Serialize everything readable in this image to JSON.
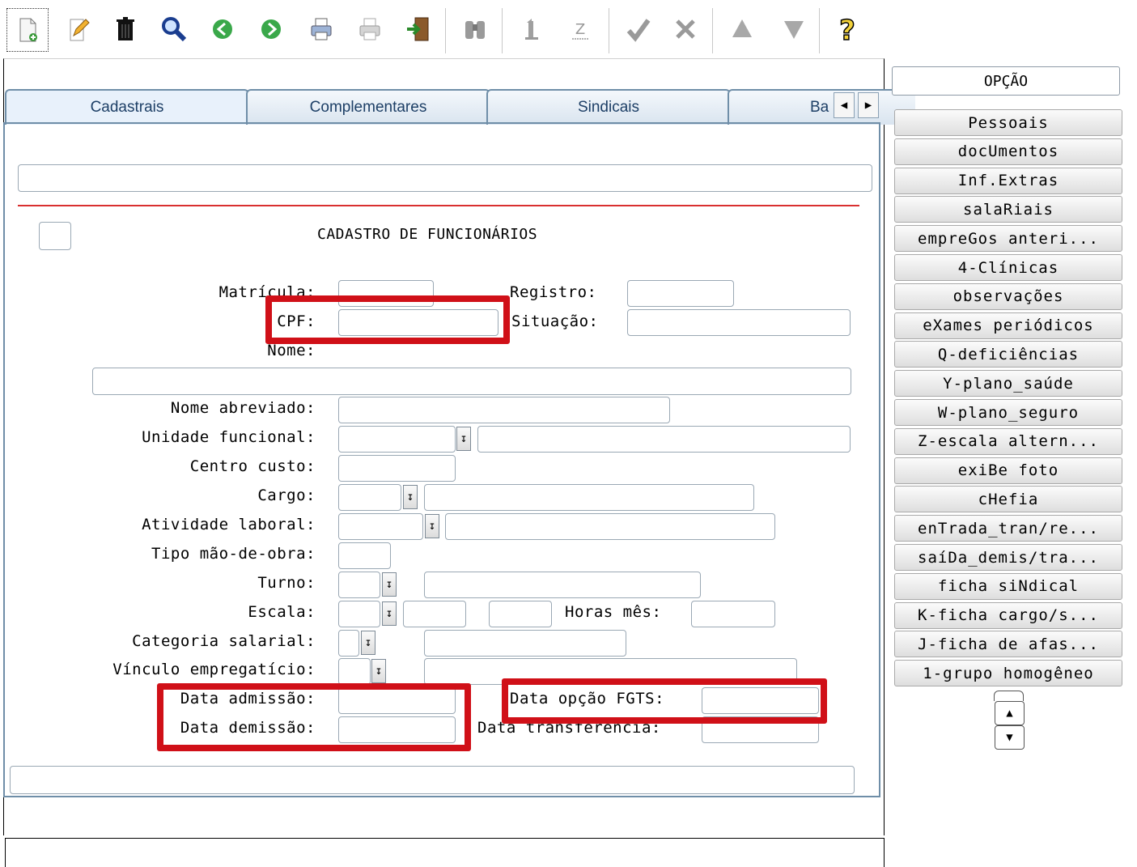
{
  "toolbar": {
    "buttons": [
      {
        "name": "new-icon"
      },
      {
        "name": "edit-icon"
      },
      {
        "name": "delete-icon"
      },
      {
        "name": "search-icon"
      },
      {
        "name": "previous-icon"
      },
      {
        "name": "next-icon"
      },
      {
        "name": "print-icon"
      },
      {
        "name": "print-disabled-icon"
      },
      {
        "name": "exit-icon"
      },
      {
        "name": "binoculars-icon"
      },
      {
        "name": "first-icon"
      },
      {
        "name": "last-icon"
      },
      {
        "name": "confirm-icon"
      },
      {
        "name": "cancel-icon"
      },
      {
        "name": "up-icon"
      },
      {
        "name": "down-icon"
      },
      {
        "name": "help-icon"
      }
    ]
  },
  "tabs": [
    "Cadastrais",
    "Complementares",
    "Sindicais",
    "Ba"
  ],
  "form": {
    "title": "CADASTRO DE FUNCIONÁRIOS",
    "labels": {
      "matricula": "Matrícula:",
      "registro": "Registro:",
      "cpf": "CPF:",
      "situacao": "Situação:",
      "nome": "Nome:",
      "nome_abreviado": "Nome abreviado:",
      "unidade_funcional": "Unidade funcional:",
      "centro_custo": "Centro custo:",
      "cargo": "Cargo:",
      "atividade_laboral": "Atividade laboral:",
      "tipo_mao_de_obra": "Tipo mão-de-obra:",
      "turno": "Turno:",
      "escala": "Escala:",
      "horas_mes": "Horas mês:",
      "categoria_salarial": "Categoria salarial:",
      "vinculo": "Vínculo empregatício:",
      "data_admissao": "Data admissão:",
      "data_opcao_fgts": "Data opção FGTS:",
      "data_demissao": "Data demissão:",
      "data_transferencia": "Data transferência:"
    }
  },
  "right_panel": {
    "header": "OPÇÃO",
    "options": [
      "Pessoais",
      "docUmentos",
      "Inf.Extras",
      "salaRiais",
      "empreGos anteri...",
      "4-Clínicas",
      "observações",
      "eXames periódicos",
      "Q-deficiências",
      "Y-plano_saúde",
      "W-plano_seguro",
      "Z-escala altern...",
      "exiBe foto",
      "cHefia",
      "enTrada_tran/re...",
      "saíDa_demis/tra...",
      "ficha siNdical",
      "K-ficha cargo/s...",
      "J-ficha de afas...",
      "1-grupo homogêneo"
    ]
  },
  "colors": {
    "highlight": "#d01018",
    "tab_border": "#6f8ea8",
    "tab_text": "#1d3f66",
    "divider": "#d93030"
  }
}
